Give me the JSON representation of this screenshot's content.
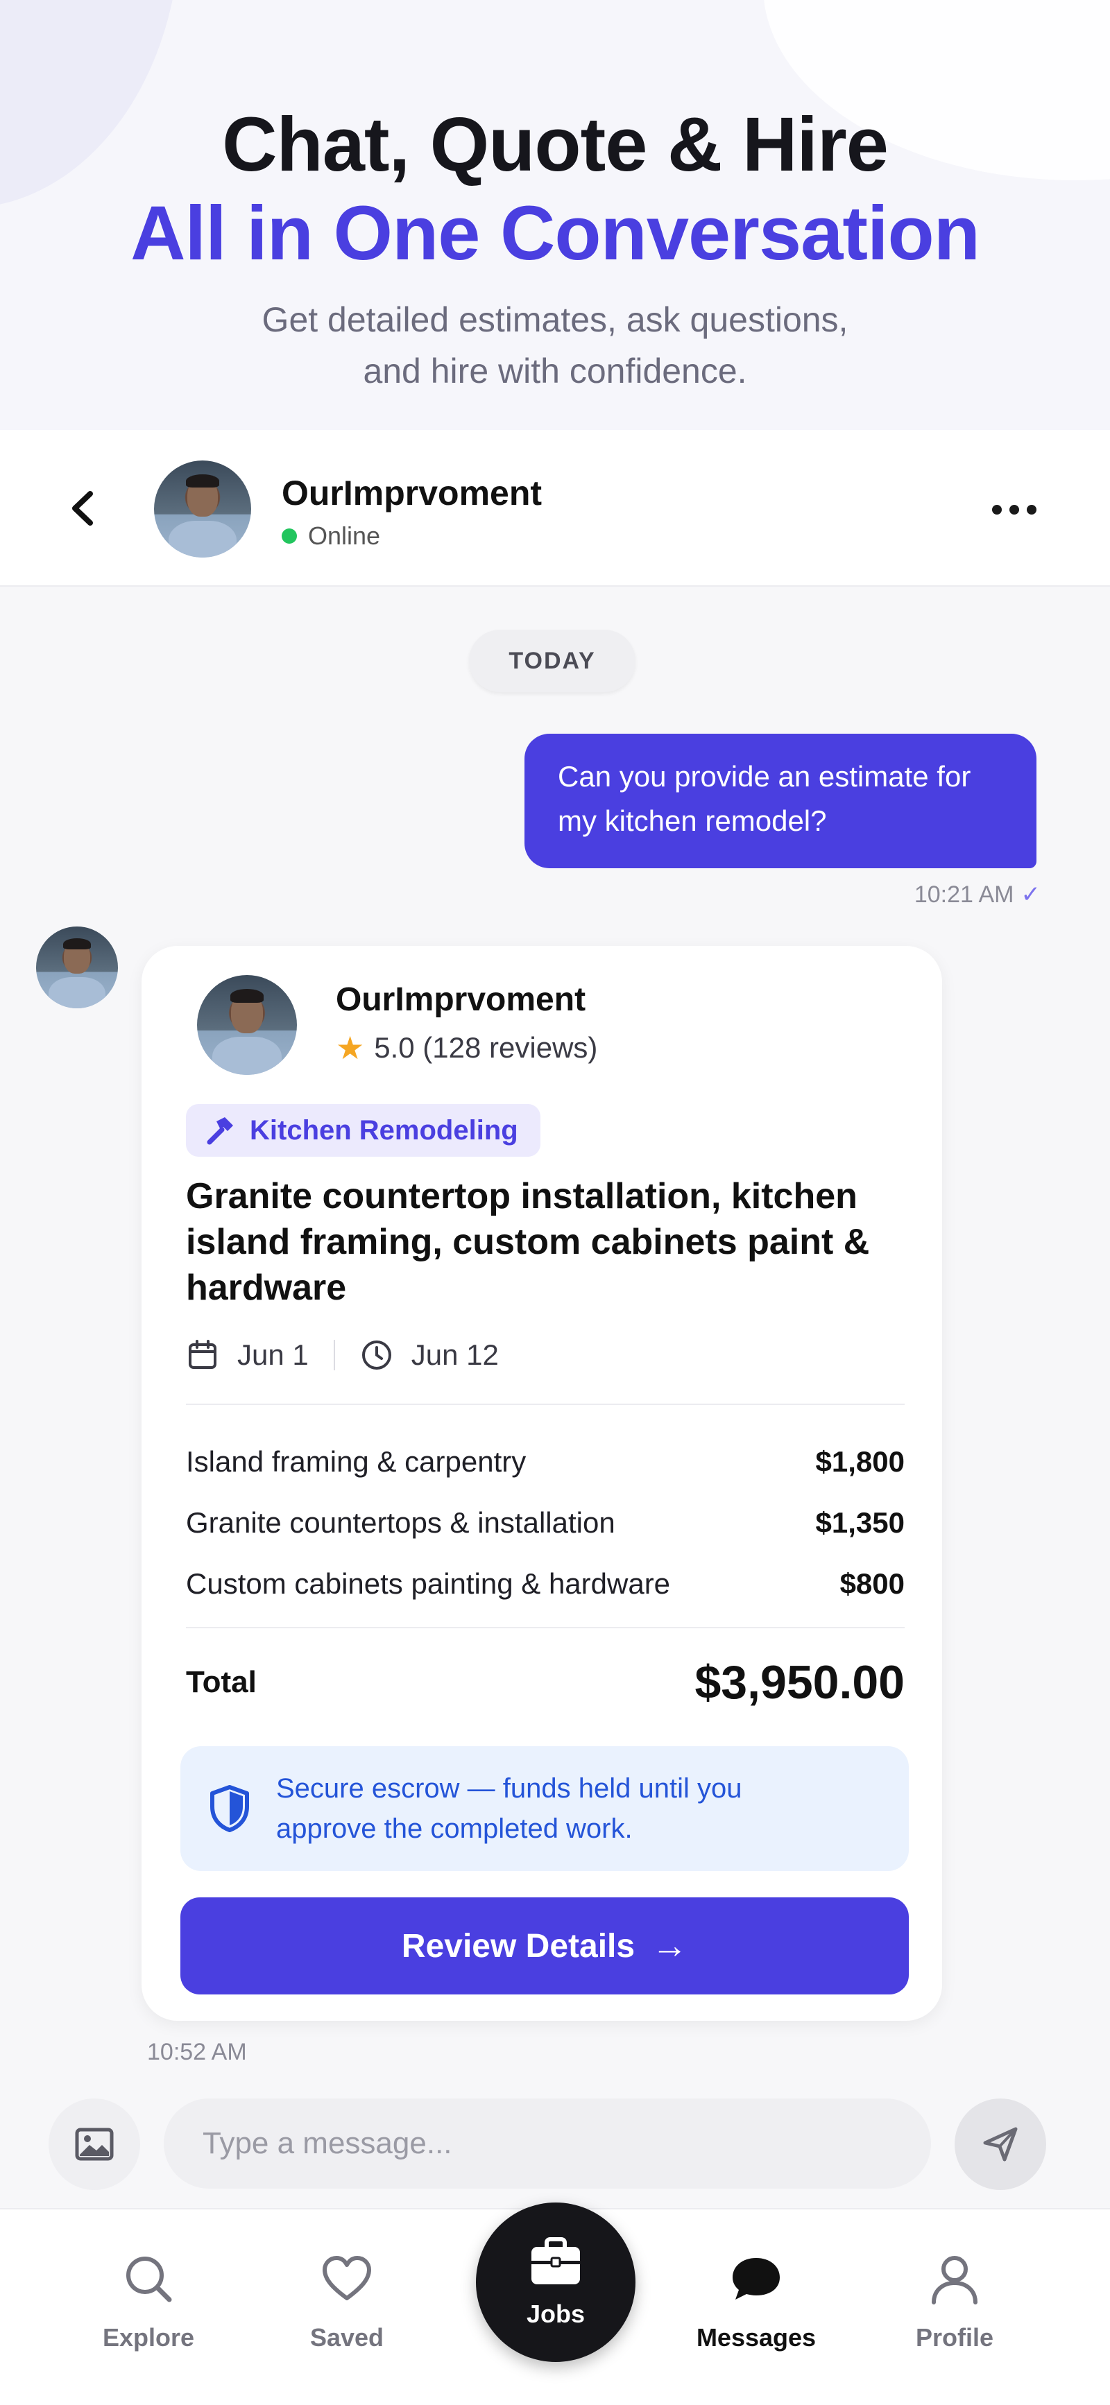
{
  "hero": {
    "title_line1": "Chat, Quote & Hire",
    "title_line2": "All in One Conversation",
    "subtitle_line1": "Get detailed estimates, ask questions,",
    "subtitle_line2": "and hire with confidence."
  },
  "header": {
    "name": "OurImprvoment",
    "status": "Online"
  },
  "thread": {
    "date_label": "TODAY",
    "outgoing": {
      "line1": "Can you provide an estimate for",
      "line2": "my kitchen remodel?",
      "time": "10:21 AM"
    },
    "incoming_time": "10:52 AM"
  },
  "quote": {
    "pro_name": "OurImprvoment",
    "rating": "5.0 (128 reviews)",
    "category": "Kitchen Remodeling",
    "title_line1": "Granite countertop installation, kitchen",
    "title_line2": "island framing, custom cabinets paint &",
    "title_line3": "hardware",
    "start_date": "Jun 1",
    "end_date": "Jun 12",
    "items": [
      {
        "label": "Island framing & carpentry",
        "amount": "$1,800"
      },
      {
        "label": "Granite countertops & installation",
        "amount": "$1,350"
      },
      {
        "label": "Custom cabinets painting & hardware",
        "amount": "$800"
      }
    ],
    "total_label": "Total",
    "total_amount": "$3,950.00",
    "escrow_line1": "Secure escrow — funds held until you",
    "escrow_line2": "approve the completed work.",
    "cta_label": "Review Details",
    "cta_arrow": "→"
  },
  "composer": {
    "placeholder": "Type a message..."
  },
  "tabs": {
    "explore": "Explore",
    "saved": "Saved",
    "jobs": "Jobs",
    "messages": "Messages",
    "profile": "Profile",
    "active": "messages"
  },
  "colors": {
    "accent": "#4a3fe0",
    "online": "#22c55e",
    "star": "#f5a623",
    "escrow_bg": "#eaf2fe",
    "escrow_text": "#2454d8"
  },
  "icons": {
    "back": "chevron-left-icon",
    "more": "more-horizontal-icon",
    "hammer": "hammer-icon",
    "calendar": "calendar-icon",
    "clock": "clock-icon",
    "shield": "shield-icon",
    "image": "image-icon",
    "send": "send-icon",
    "explore": "search-icon",
    "saved": "heart-icon",
    "jobs": "briefcase-icon",
    "messages": "chat-bubble-icon",
    "profile": "user-icon"
  }
}
